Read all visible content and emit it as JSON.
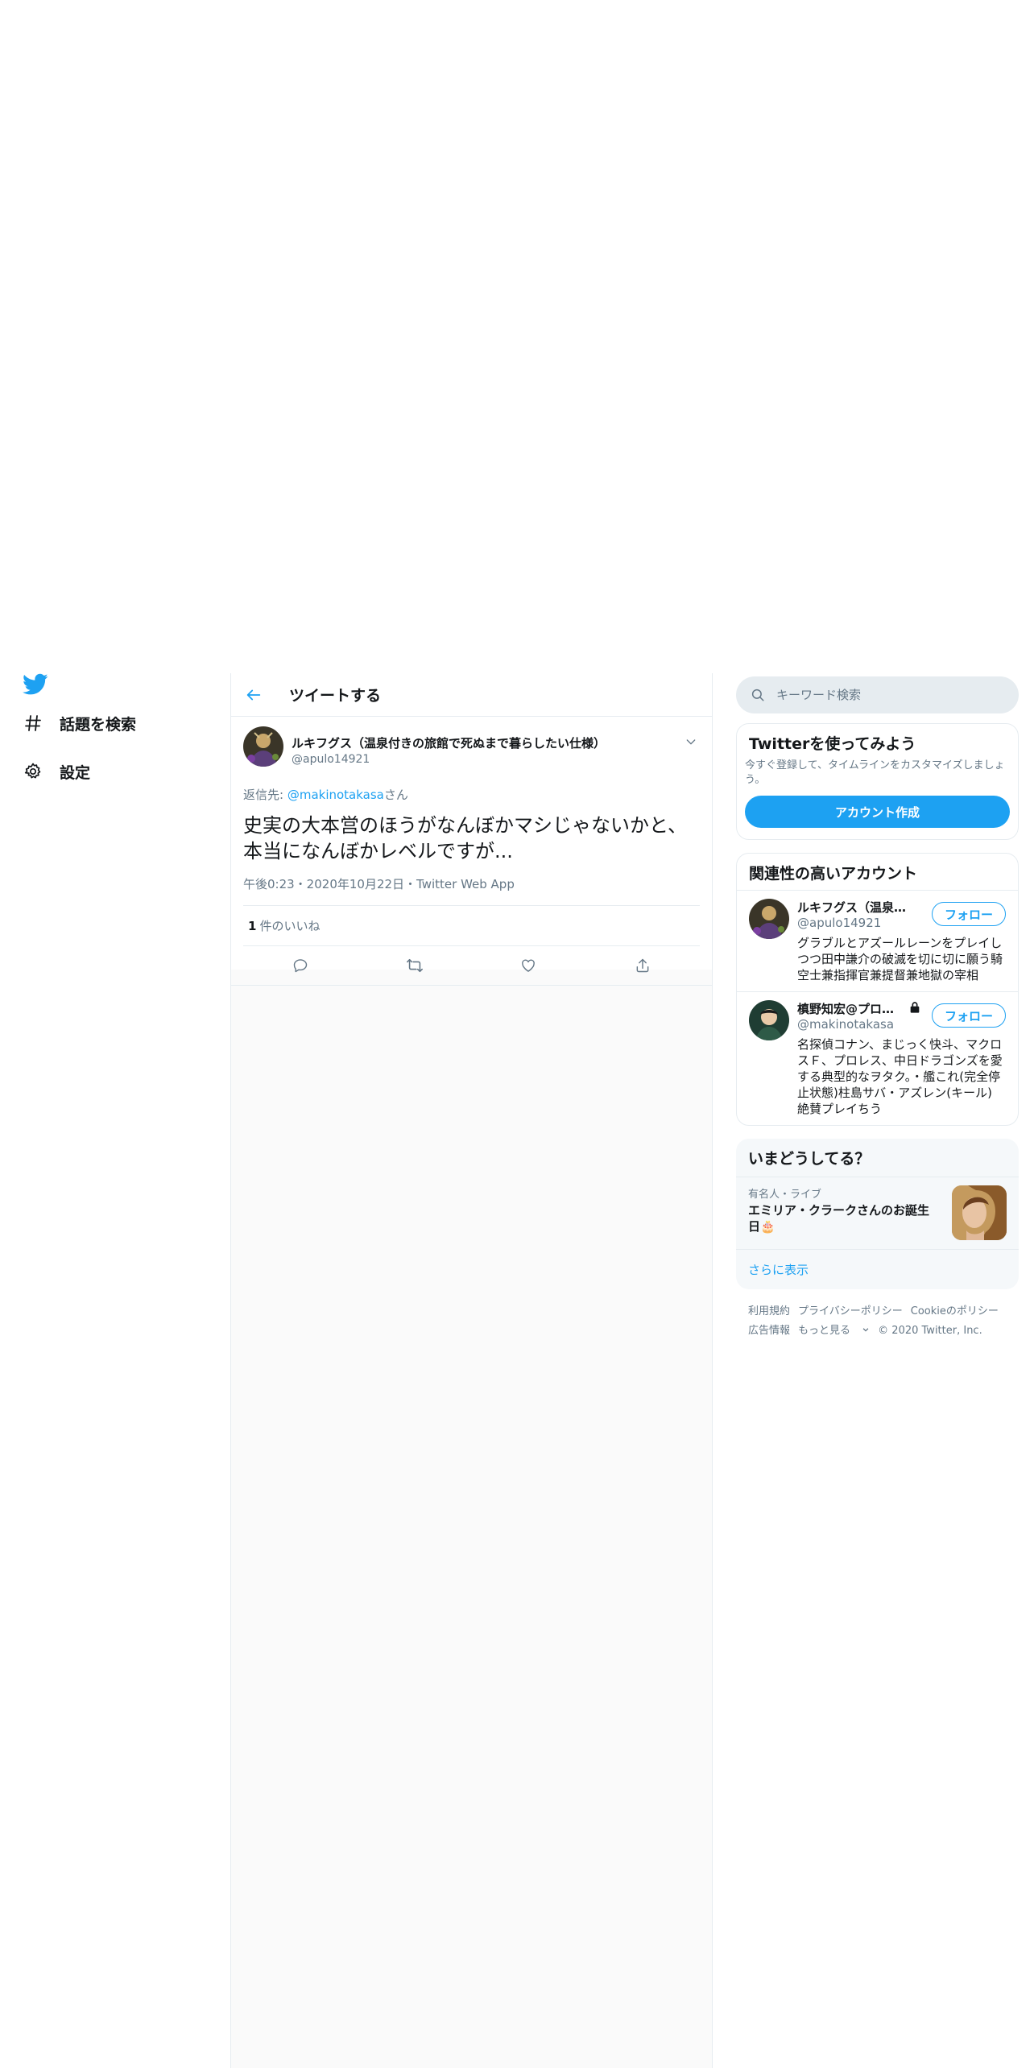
{
  "nav": {
    "logo": "twitter-bird-icon",
    "items": [
      {
        "label": "話題を検索",
        "icon": "hashtag-icon"
      },
      {
        "label": "設定",
        "icon": "gear-icon"
      }
    ]
  },
  "main": {
    "header_title": "ツイートする",
    "tweet": {
      "display_name": "ルキフグス（温泉付きの旅館で死ぬまで暮らしたい仕様）",
      "handle": "@apulo14921",
      "reply_prefix": "返信先: ",
      "reply_mention": "@makinotakasa",
      "reply_suffix": "さん",
      "text_line1": "史実の大本営のほうがなんぼかマシじゃないかと、",
      "text_line2": "本当になんぼかレベルですが...",
      "meta": "午後0:23・2020年10月22日・Twitter Web App",
      "like_count": "1",
      "like_label": "件のいいね"
    }
  },
  "right": {
    "search_placeholder": "キーワード検索",
    "signup": {
      "title": "Twitterを使ってみよう",
      "desc": "今すぐ登録して、タイムラインをカスタマイズしましょう。",
      "button": "アカウント作成"
    },
    "who_to_follow": {
      "title": "関連性の高いアカウント",
      "follow_label": "フォロー",
      "accounts": [
        {
          "name": "ルキフグス（温泉付...",
          "handle": "@apulo14921",
          "bio": "グラブルとアズールレーンをプレイしつつ田中謙介の破滅を切に切に願う騎空士兼指揮官兼提督兼地獄の宰相"
        },
        {
          "name": "槙野知宏@プロレ...",
          "handle": "@makinotakasa",
          "bio": "名探偵コナン、まじっく快斗、マクロスＦ、プロレス、中日ドラゴンズを愛する典型的なヲタク。・艦これ(完全停止状態)柱島サバ・アズレン(キール)絶賛プレイちう"
        }
      ]
    },
    "trends": {
      "title": "いまどうしてる？",
      "item_meta": "有名人・ライブ",
      "item_title": "エミリア・クラークさんのお誕生日🎂",
      "show_more": "さらに表示"
    },
    "footer": {
      "terms": "利用規約",
      "privacy": "プライバシーポリシー",
      "cookie": "Cookieのポリシー",
      "ads": "広告情報",
      "more": "もっと見る",
      "copyright": "© 2020 Twitter, Inc."
    }
  },
  "colors": {
    "accent": "#1da1f2",
    "text": "#14171a",
    "secondary": "#657786",
    "border": "#e6ecf0"
  }
}
